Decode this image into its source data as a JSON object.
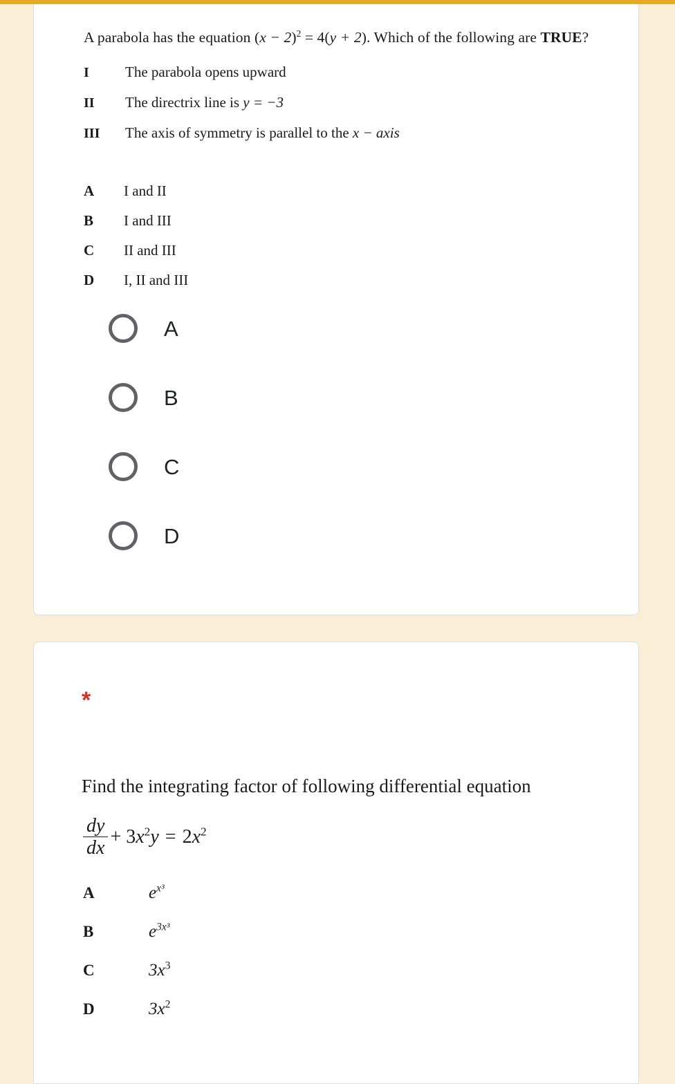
{
  "theme": {
    "page_background": "#faefd6",
    "card_background": "#ffffff",
    "top_bar_color": "#e3ab26",
    "card_border_color": "#dadce0",
    "radio_border_color": "#5f6368",
    "required_asterisk_color": "#d93025",
    "text_color": "#1a1a1a"
  },
  "question_1": {
    "stem": {
      "lead": "A parabola has the equation",
      "equation_open_paren": "(",
      "equation_x_minus_2": "x − 2",
      "equation_close_paren": ")",
      "equation_exponent": "2",
      "equation_equals": "= 4",
      "equation_rhs_open": "(",
      "equation_y_plus_2": "y + 2",
      "equation_rhs_close": ")",
      "tail_before_bold": ". Which of the following are ",
      "tail_bold": "TRUE",
      "tail_after_bold": "?",
      "full_text": "A parabola has the equation (x − 2)² = 4(y + 2). Which of the following are TRUE?"
    },
    "statements": [
      {
        "numeral": "I",
        "text": "The parabola opens upward"
      },
      {
        "numeral": "II",
        "text": "The directrix line is ",
        "math": "y = −3"
      },
      {
        "numeral": "III",
        "text": "The axis of symmetry is parallel to the ",
        "math": "x − axis"
      }
    ],
    "options_text": [
      {
        "letter": "A",
        "text": "I and II"
      },
      {
        "letter": "B",
        "text": "I and III"
      },
      {
        "letter": "C",
        "text": "II and III"
      },
      {
        "letter": "D",
        "text": "I, II and III"
      }
    ],
    "radio_choices": [
      {
        "label": "A",
        "selected": false
      },
      {
        "label": "B",
        "selected": false
      },
      {
        "label": "C",
        "selected": false
      },
      {
        "label": "D",
        "selected": false
      }
    ]
  },
  "question_2": {
    "required_marker": "*",
    "stem": "Find the integrating factor of following differential equation",
    "equation": {
      "fraction_numerator": "dy",
      "fraction_denominator": "dx",
      "plus_term_coefficient": "+ 3",
      "plus_term_variable": "x",
      "plus_term_exponent": "2",
      "plus_term_y": "y",
      "equals": "=",
      "rhs_coefficient": "2",
      "rhs_variable": "x",
      "rhs_exponent": "2",
      "plain": "dy/dx + 3x²y = 2x²"
    },
    "options": [
      {
        "letter": "A",
        "base": "e",
        "exponent": "x³",
        "plain": "e^(x³)"
      },
      {
        "letter": "B",
        "base": "e",
        "exponent": "3x³",
        "plain": "e^(3x³)"
      },
      {
        "letter": "C",
        "base": "3x",
        "exponent": "3",
        "plain": "3x³"
      },
      {
        "letter": "D",
        "base": "3x",
        "exponent": "2",
        "plain": "3x²"
      }
    ]
  }
}
